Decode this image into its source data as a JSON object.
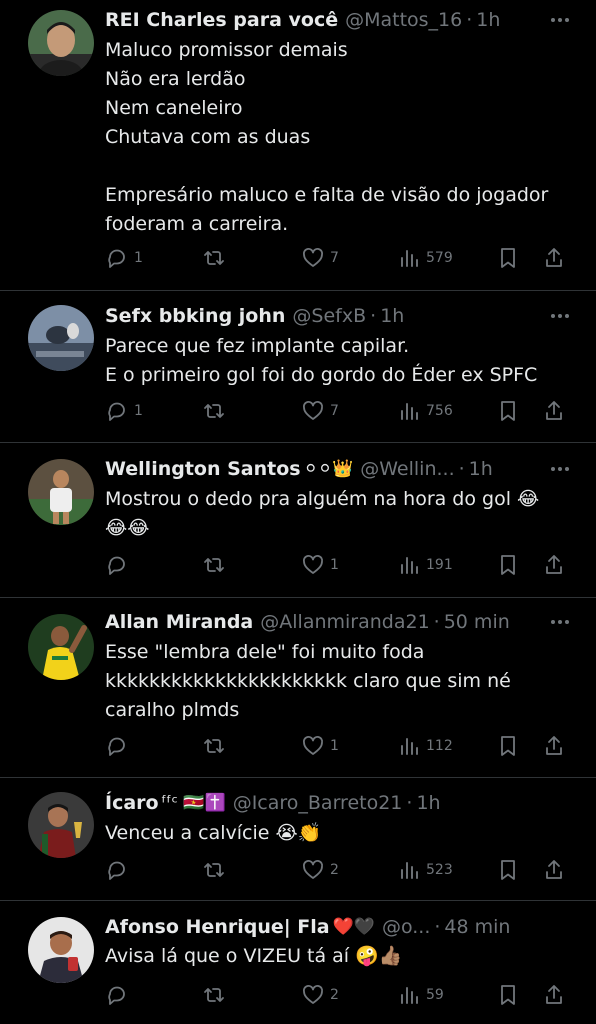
{
  "tweets": [
    {
      "name": "REI Charles para você",
      "handle": "@Mattos_16",
      "sep": "·",
      "time": "1h",
      "text": "Maluco promissor demais\nNão era lerdão\nNem caneleiro\nChutava com as duas\n\nEmpresário maluco e falta de visão do jogador\nfoderam a carreira.",
      "replies": "1",
      "retweets": "",
      "likes": "7",
      "views": "579"
    },
    {
      "name": "Sefx bbking john",
      "handle": "@SefxB",
      "sep": "·",
      "time": "1h",
      "text": "Parece que fez implante capilar.\nE o primeiro gol foi do gordo do Éder ex SPFC",
      "replies": "1",
      "retweets": "",
      "likes": "7",
      "views": "756"
    },
    {
      "name": "Wellington Santos",
      "name_emoji": "⚪⚪👑",
      "handle": "@Wellin...",
      "sep": "·",
      "time": "1h",
      "text": "Mostrou o dedo pra alguém na hora do gol 😂\n😂😂",
      "replies": "",
      "retweets": "",
      "likes": "1",
      "views": "191"
    },
    {
      "name": "Allan Miranda",
      "handle": "@Allanmiranda21",
      "sep": "·",
      "time": "50 min",
      "text": "Esse \"lembra dele\" foi muito foda\nkkkkkkkkkkkkkkkkkkkkkk claro que sim né\ncaralho plmds",
      "replies": "",
      "retweets": "",
      "likes": "1",
      "views": "112"
    },
    {
      "name": "Ícaro",
      "name_emoji": "ᶠᶠᶜ 🇸🇷✝️",
      "handle": "@Icaro_Barreto21",
      "sep": "·",
      "time": "1h",
      "text": "Venceu a calvície 😭👏",
      "replies": "",
      "retweets": "",
      "likes": "2",
      "views": "523"
    },
    {
      "name": "Afonso Henrique| Fla",
      "name_emoji": "❤️🖤",
      "handle": "@o...",
      "sep": "·",
      "time": "48 min",
      "text": "Avisa lá que o VIZEU tá aí 🤪👍🏽",
      "replies": "",
      "retweets": "",
      "likes": "2",
      "views": "59"
    }
  ],
  "colors": {
    "background": "#000000",
    "text_primary": "#e7e9ea",
    "text_secondary": "#71767b",
    "divider": "#2f3336"
  },
  "icons": {
    "reply": "reply-icon",
    "retweet": "retweet-icon",
    "like": "like-icon",
    "views": "views-icon",
    "bookmark": "bookmark-icon",
    "share": "share-icon",
    "more": "more-icon"
  }
}
